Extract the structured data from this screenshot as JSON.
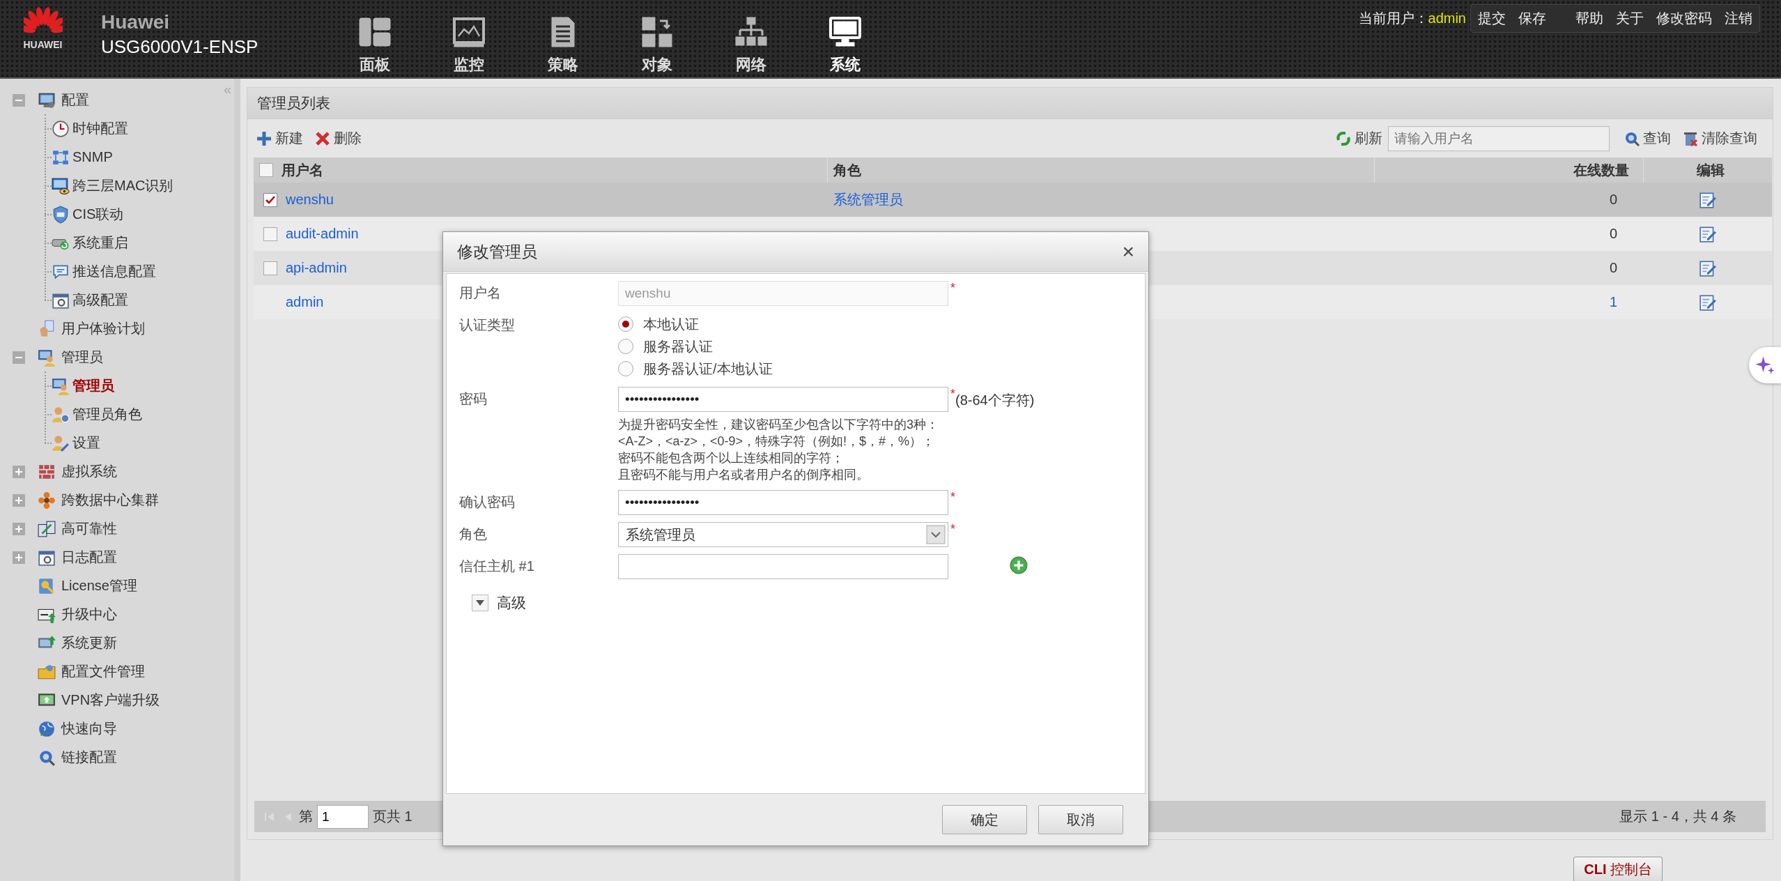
{
  "header": {
    "logo_text": "HUAWEI",
    "brand": "Huawei",
    "model": "USG6000V1-ENSP",
    "nav": [
      {
        "label": "面板",
        "selected": false
      },
      {
        "label": "监控",
        "selected": false
      },
      {
        "label": "策略",
        "selected": false
      },
      {
        "label": "对象",
        "selected": false
      },
      {
        "label": "网络",
        "selected": false
      },
      {
        "label": "系统",
        "selected": true
      }
    ],
    "user_label": "当前用户：",
    "user": "admin",
    "links": [
      "提交",
      "保存",
      "帮助",
      "关于",
      "修改密码",
      "注销"
    ]
  },
  "sidebar": {
    "collapse": "«",
    "items": [
      {
        "label": "配置",
        "expanded": true,
        "selected": false,
        "children": [
          {
            "label": "时钟配置",
            "selected": false
          },
          {
            "label": "SNMP",
            "selected": false
          },
          {
            "label": "跨三层MAC识别",
            "selected": false
          },
          {
            "label": "CIS联动",
            "selected": false
          },
          {
            "label": "系统重启",
            "selected": false
          },
          {
            "label": "推送信息配置",
            "selected": false
          },
          {
            "label": "高级配置",
            "selected": false
          }
        ]
      },
      {
        "label": "用户体验计划",
        "selected": false
      },
      {
        "label": "管理员",
        "expanded": true,
        "selected": false,
        "children": [
          {
            "label": "管理员",
            "selected": true
          },
          {
            "label": "管理员角色",
            "selected": false
          },
          {
            "label": "设置",
            "selected": false
          }
        ]
      },
      {
        "label": "虚拟系统",
        "expanded": false,
        "selected": false
      },
      {
        "label": "跨数据中心集群",
        "expanded": false,
        "selected": false
      },
      {
        "label": "高可靠性",
        "expanded": false,
        "selected": false
      },
      {
        "label": "日志配置",
        "expanded": false,
        "selected": false
      },
      {
        "label": "License管理",
        "selected": false
      },
      {
        "label": "升级中心",
        "selected": false
      },
      {
        "label": "系统更新",
        "selected": false
      },
      {
        "label": "配置文件管理",
        "selected": false
      },
      {
        "label": "VPN客户端升级",
        "selected": false
      },
      {
        "label": "快速向导",
        "selected": false
      },
      {
        "label": "链接配置",
        "selected": false
      }
    ]
  },
  "panel": {
    "title": "管理员列表",
    "toolbar": {
      "new": "新建",
      "delete": "删除",
      "refresh": "刷新",
      "search": {
        "placeholder": "请输入用户名"
      },
      "query": "查询",
      "clear": "清除查询"
    },
    "table": {
      "columns": [
        {
          "label": "用户名"
        },
        {
          "label": "角色"
        },
        {
          "label": "在线数量"
        },
        {
          "label": "编辑"
        }
      ],
      "header_checked": false,
      "rows": [
        {
          "username": "wenshu",
          "role": "系统管理员",
          "online": "0",
          "checked": true,
          "selected": true,
          "online_link": false
        },
        {
          "username": "audit-admin",
          "online": "0",
          "checked": false,
          "selected": false,
          "online_link": false
        },
        {
          "username": "api-admin",
          "online": "0",
          "checked": false,
          "selected": false,
          "online_link": false
        },
        {
          "username": "admin",
          "online": "1",
          "selected": false,
          "online_link": true
        }
      ]
    },
    "pager": {
      "prefix": "第",
      "page": "1",
      "suffix": "页共 1",
      "summary": "显示 1 - 4，共 4 条"
    }
  },
  "dialog": {
    "title": "修改管理员",
    "close": "×",
    "fields": [
      {
        "kind": "text",
        "label": "用户名",
        "value": "wenshu",
        "disabled": true,
        "required_mark": "*"
      },
      {
        "kind": "radio",
        "label": "认证类型",
        "options": [
          {
            "label": "本地认证",
            "selected": true
          },
          {
            "label": "服务器认证",
            "selected": false
          },
          {
            "label": "服务器认证/本地认证",
            "selected": false
          }
        ]
      },
      {
        "kind": "text",
        "label": "密码",
        "value": "••••••••••••••••",
        "disabled": false,
        "required_mark": "*",
        "note": "(8-64个字符)",
        "hint_lines": [
          "为提升密码安全性，建议密码至少包含以下字符中的3种：",
          "<A-Z>，<a-z>，<0-9>，特殊字符（例如!，$，#，%）；",
          "密码不能包含两个以上连续相同的字符；",
          "且密码不能与用户名或者用户名的倒序相同。"
        ]
      },
      {
        "kind": "text",
        "label": "确认密码",
        "value": "••••••••••••••••",
        "disabled": false,
        "required_mark": "*"
      },
      {
        "kind": "select",
        "label": "角色",
        "value": "系统管理员",
        "required_mark": "*"
      },
      {
        "kind": "text",
        "label": "信任主机 #1",
        "disabled": false,
        "add": true
      }
    ],
    "advanced": {
      "label": "高级",
      "expanded": false
    },
    "buttons": [
      "确定",
      "取消"
    ]
  },
  "footer": {
    "cli": "**CLI** 控制台"
  }
}
